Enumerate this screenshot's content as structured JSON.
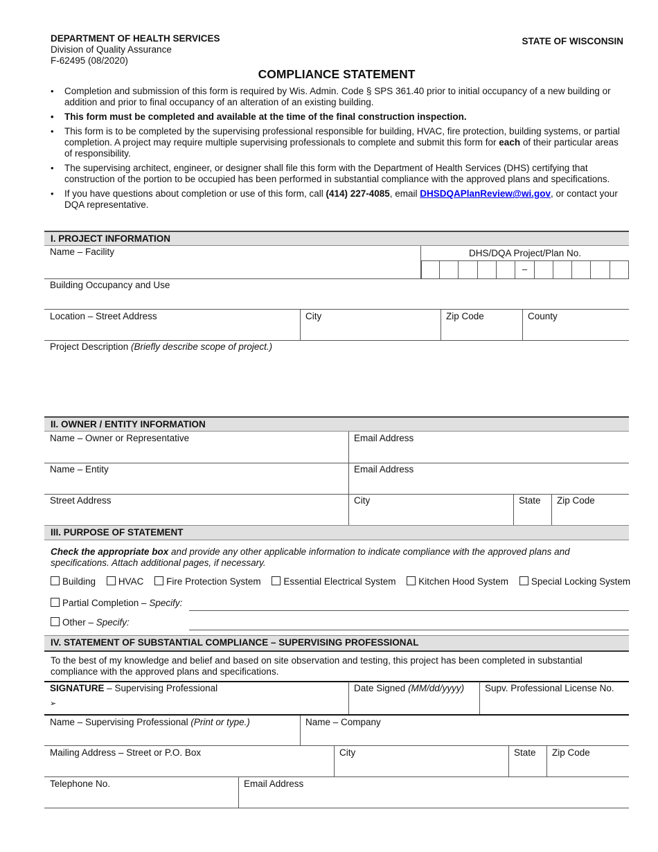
{
  "header": {
    "department": "DEPARTMENT OF HEALTH SERVICES",
    "division": "Division of Quality Assurance",
    "form_id": "F-62495  (08/2020)",
    "state": "STATE OF WISCONSIN",
    "title": "COMPLIANCE STATEMENT"
  },
  "instructions": {
    "b1": "Completion and submission of this form is required by Wis. Admin. Code § SPS 361.40 prior to initial occupancy of a new building or addition and prior to final occupancy of an alteration of an existing building.",
    "b2": "This form must be completed and available at the time of the final construction inspection.",
    "b3_pre": "This form is to be completed by the supervising professional responsible for building, HVAC, fire protection, building systems, or partial completion. A project may require multiple supervising professionals to complete and submit this form for ",
    "b3_bold": "each",
    "b3_post": " of their particular areas of responsibility.",
    "b4": "The supervising architect, engineer, or designer shall file this form with the Department of Health Services (DHS) certifying that construction of the portion to be occupied has been performed in substantial compliance with the approved plans and specifications.",
    "b5_pre": "If you have questions about completion or use of this form, call ",
    "b5_phone": "(414) 227-4085",
    "b5_mid": ", email ",
    "b5_email": "DHSDQAPlanReview@wi.gov",
    "b5_post": ", or contact your DQA representative."
  },
  "section1": {
    "title": "I.  PROJECT INFORMATION",
    "name_facility": "Name – Facility",
    "plan_no_label": "DHS/DQA Project/Plan No.",
    "plan_no_separator": "–",
    "occupancy": "Building Occupancy and Use",
    "street": "Location – Street Address",
    "city": "City",
    "zip": "Zip Code",
    "county": "County",
    "desc_label": "Project Description ",
    "desc_hint": "(Briefly describe scope of project.)"
  },
  "section2": {
    "title": "II.  OWNER / ENTITY INFORMATION",
    "owner_name": "Name – Owner or Representative",
    "owner_email": "Email Address",
    "entity_name": "Name – Entity",
    "entity_email": "Email Address",
    "street": "Street Address",
    "city": "City",
    "state": "State",
    "zip": "Zip Code"
  },
  "section3": {
    "title": "III.  PURPOSE OF STATEMENT",
    "instr_bold": "Check the appropriate box",
    "instr_rest": " and provide any other applicable information to indicate compliance with the approved plans and specifications. Attach additional pages, if necessary.",
    "checkboxes": [
      "Building",
      "HVAC",
      "Fire Protection System",
      "Essential Electrical System",
      "Kitchen Hood System",
      "Special Locking System"
    ],
    "partial_label": "Partial Completion – ",
    "partial_specify": "Specify:",
    "other_label": "Other – ",
    "other_specify": "Specify:"
  },
  "section4": {
    "title": "IV.  STATEMENT OF SUBSTANTIAL COMPLIANCE – SUPERVISING PROFESSIONAL",
    "statement": "To the best of my knowledge and belief and based on site observation and testing, this project has been completed in substantial compliance with the approved plans and specifications.",
    "sig_bold": "SIGNATURE",
    "sig_rest": " – Supervising Professional",
    "sig_arrow": "➢",
    "date_label": "Date Signed ",
    "date_hint": "(MM/dd/yyyy)",
    "license": "Supv. Professional License No.",
    "prof_name": "Name – Supervising Professional ",
    "prof_name_hint": "(Print or type.)",
    "company": "Name – Company",
    "mailing": "Mailing Address – Street or P.O. Box",
    "city": "City",
    "state": "State",
    "zip": "Zip Code",
    "phone": "Telephone No.",
    "email": "Email Address"
  }
}
